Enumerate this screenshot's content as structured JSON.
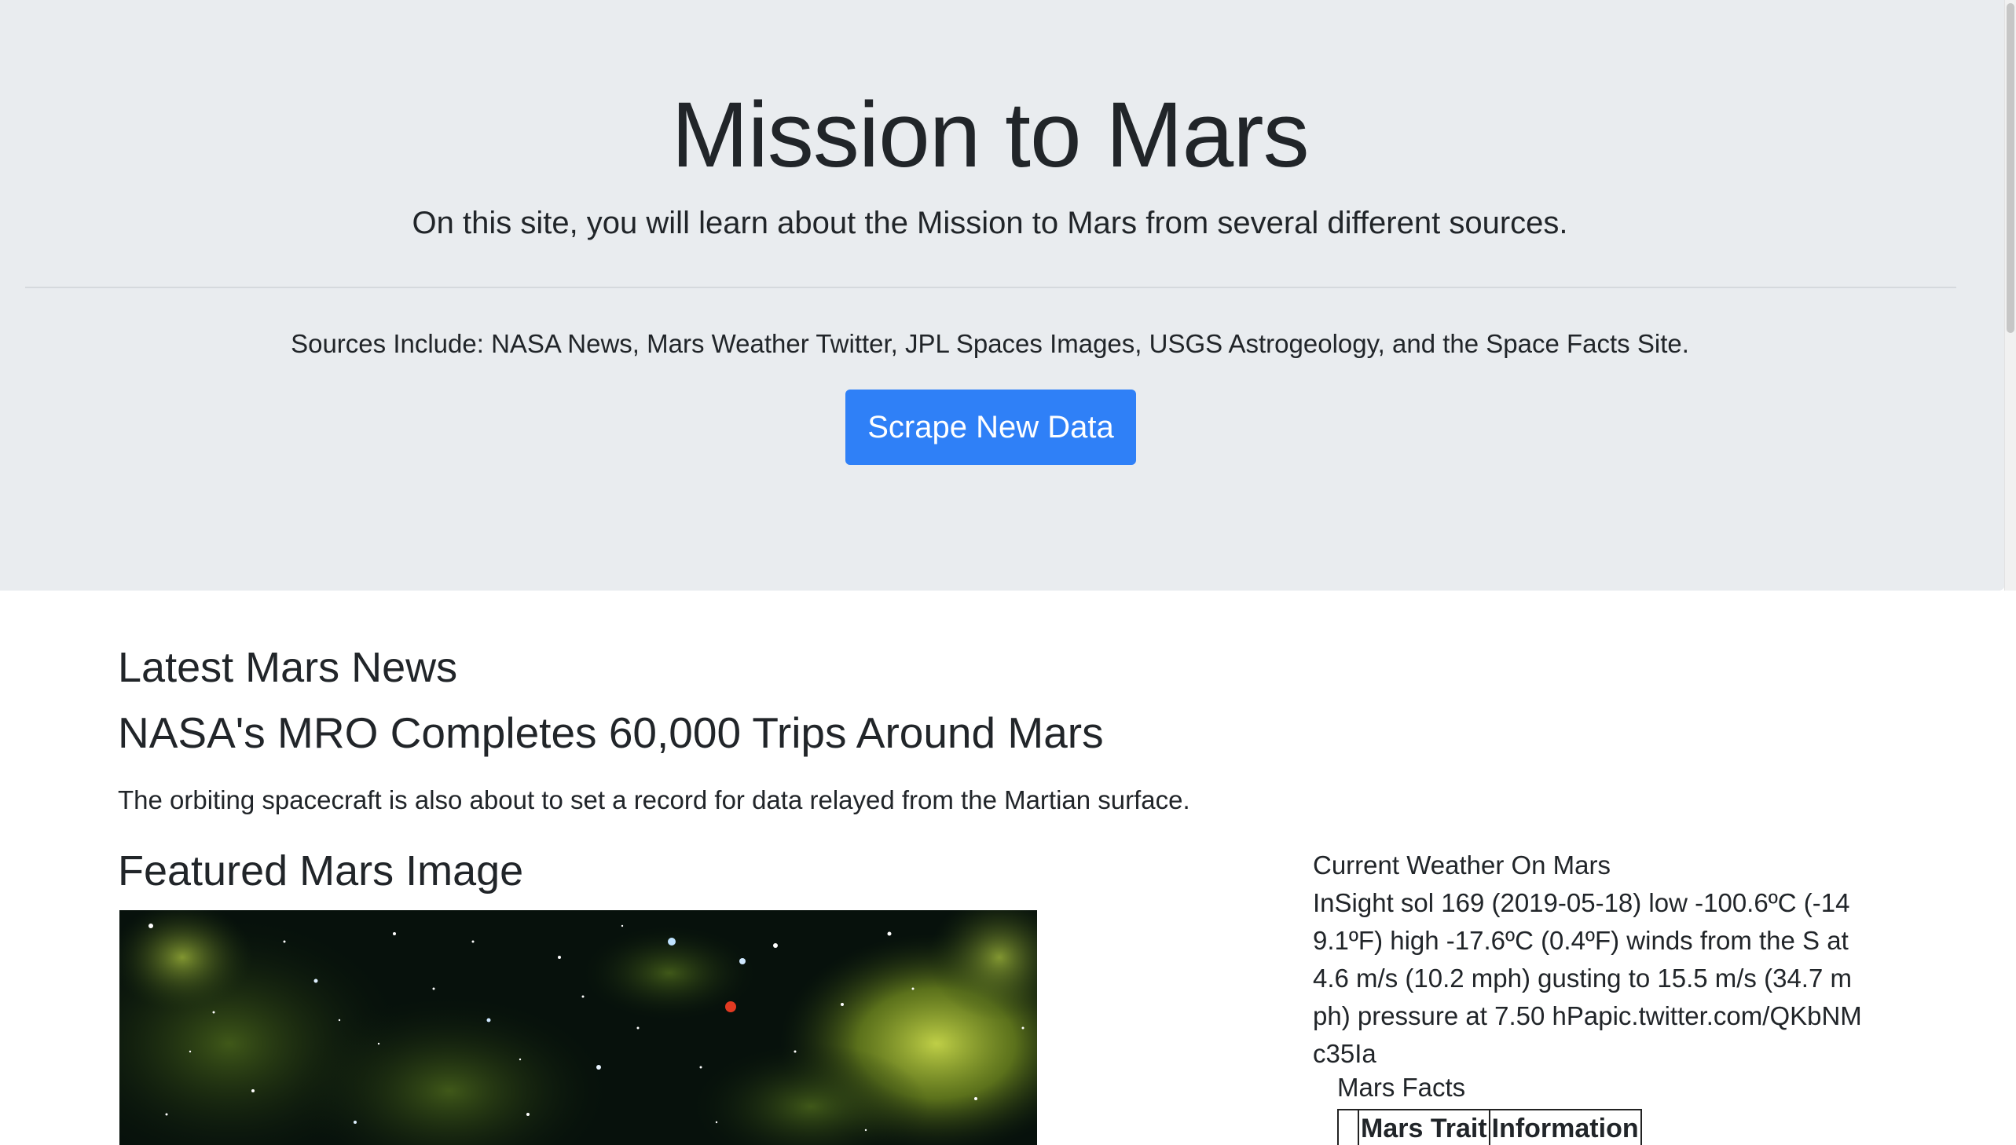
{
  "jumbotron": {
    "title": "Mission to Mars",
    "lead": "On this site, you will learn about the Mission to Mars from several different sources.",
    "sources": "Sources Include: NASA News, Mars Weather Twitter, JPL Spaces Images, USGS Astrogeology, and the Space Facts Site.",
    "button_label": "Scrape New Data"
  },
  "news": {
    "heading": "Latest Mars News",
    "title": "NASA's MRO Completes 60,000 Trips Around Mars",
    "paragraph": "The orbiting spacecraft is also about to set a record for data relayed from the Martian surface."
  },
  "featured": {
    "heading": "Featured Mars Image"
  },
  "weather": {
    "heading": "Current Weather On Mars",
    "text": "InSight sol 169 (2019-05-18) low -100.6ºC (-149.1ºF) high -17.6ºC (0.4ºF) winds from the S at 4.6 m/s (10.2 mph) gusting to 15.5 m/s (34.7 mph) pressure at 7.50 hPapic.twitter.com/QKbNMc35Ia"
  },
  "facts": {
    "label": "Mars Facts",
    "columns": [
      "",
      "Mars Trait",
      "Information"
    ]
  },
  "colors": {
    "jumbotron_bg": "#e9ecef",
    "button_bg": "#2f80f7",
    "text": "#212529"
  }
}
